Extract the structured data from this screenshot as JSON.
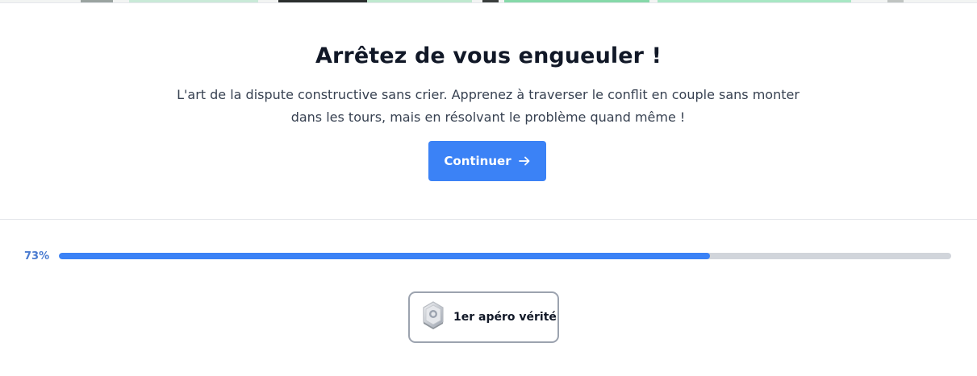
{
  "hero": {
    "title": "Arrêtez de vous engueuler !",
    "description_line1": "L'art de la dispute constructive sans crier. Apprenez à traverser le conflit en couple sans monter",
    "description_line2": "dans les tours, mais en résolvant le problème quand même !",
    "continue_label": "Continuer",
    "continue_icon": "arrow-right-icon"
  },
  "progress": {
    "label": "73%",
    "value": 0.73
  },
  "badge": {
    "label": "1er apéro vérité",
    "icon": "hexagon-medal-icon"
  },
  "colors": {
    "accent": "#3b82f6",
    "progress_text": "#4a7bd0",
    "track": "#d1d5db",
    "title": "#111827"
  }
}
